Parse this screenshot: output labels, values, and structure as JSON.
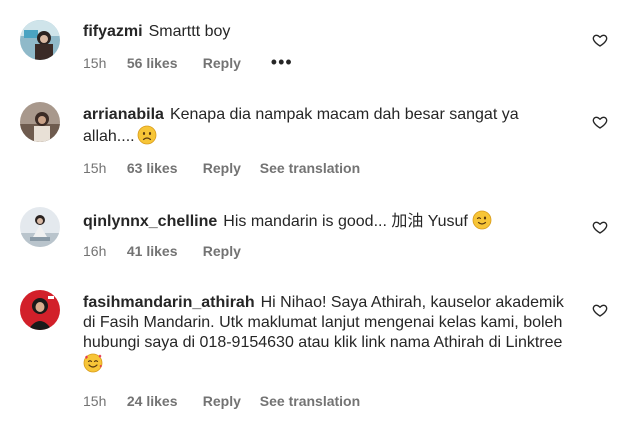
{
  "comments": [
    {
      "username": "fifyazmi",
      "text": "Smarttt boy",
      "time": "15h",
      "likes": "56 likes",
      "reply": "Reply",
      "extra": "",
      "more_icon": "ellipsis-icon",
      "avatar": "user-avatar-photo"
    },
    {
      "username": "arrianabila",
      "text": "Kenapa dia nampak macam dah besar sangat ya allah....",
      "emoji": "sad-face-emoji",
      "time": "15h",
      "likes": "63 likes",
      "reply": "Reply",
      "extra": "See translation",
      "avatar": "user-avatar-photo"
    },
    {
      "username": "qinlynnx_chelline",
      "text": "His mandarin is good... 加油 Yusuf",
      "emoji": "wink-face-emoji",
      "time": "16h",
      "likes": "41 likes",
      "reply": "Reply",
      "extra": "",
      "avatar": "user-avatar-photo"
    },
    {
      "username": "fasihmandarin_athirah",
      "text": "Hi Nihao! Saya Athirah, kauselor akademik di Fasih Mandarin. Utk maklumat lanjut mengenai kelas kami, boleh hubungi saya di 018-9154630 atau klik link nama Athirah di Linktree",
      "emoji": "smiling-face-with-hearts-emoji",
      "time": "15h",
      "likes": "24 likes",
      "reply": "Reply",
      "extra": "See translation",
      "avatar": "user-avatar-photo"
    }
  ],
  "colors": {
    "text": "#262626",
    "secondary": "#737373",
    "heart_outline": "#262626"
  },
  "icons": {
    "like": "heart-outline-icon"
  }
}
